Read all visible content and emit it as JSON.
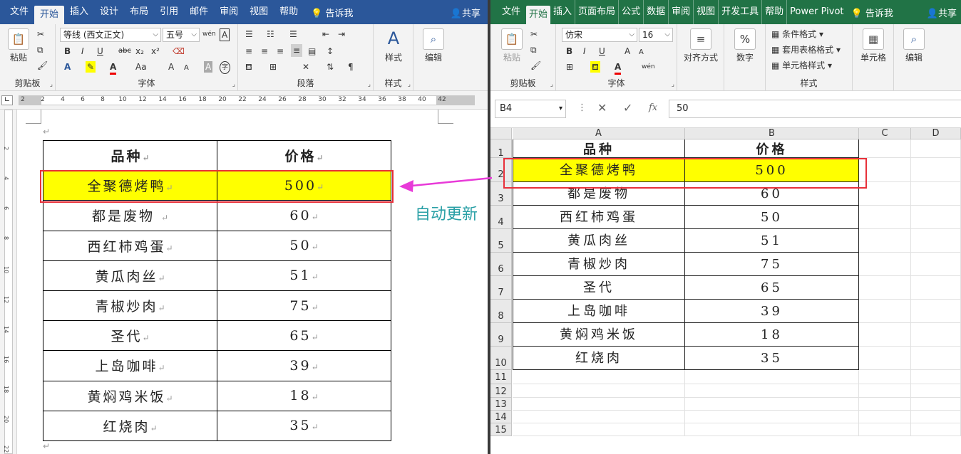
{
  "colors": {
    "word_accent": "#2b579a",
    "excel_accent": "#217346",
    "highlight": "#ffff00",
    "outline": "#e8303a",
    "arrow": "#e83ad8",
    "annotation": "#2aa0a6"
  },
  "word": {
    "tabs": [
      "文件",
      "开始",
      "插入",
      "设计",
      "布局",
      "引用",
      "邮件",
      "审阅",
      "视图",
      "帮助"
    ],
    "active_tab": "开始",
    "tell_me": "告诉我",
    "share": "共享",
    "ribbon": {
      "clipboard": {
        "label": "剪贴板",
        "paste": "粘贴"
      },
      "font": {
        "label": "字体",
        "font_name": "等线 (西文正文)",
        "font_size": "五号",
        "bold": "B",
        "italic": "I",
        "underline": "U",
        "strike": "abc",
        "sub": "x₂",
        "sup": "x²",
        "change_case": "Aa",
        "grow": "A",
        "shrink": "A",
        "pinyin": "wén",
        "border_char": "A"
      },
      "paragraph": {
        "label": "段落"
      },
      "styles": {
        "label": "样式",
        "button": "样式"
      },
      "editing": {
        "button": "编辑"
      }
    },
    "ruler_ticks": [
      "2",
      "2",
      "4",
      "6",
      "8",
      "10",
      "12",
      "14",
      "16",
      "18",
      "20",
      "22",
      "24",
      "26",
      "28",
      "30",
      "32",
      "34",
      "36",
      "38",
      "40",
      "42"
    ],
    "vruler_ticks": [
      "2",
      "4",
      "6",
      "8",
      "10",
      "12",
      "14",
      "16",
      "18",
      "20",
      "22"
    ],
    "table": {
      "header": [
        "品种",
        "价格"
      ],
      "rows": [
        [
          "全聚德烤鸭",
          "500"
        ],
        [
          "都是废物 ",
          "60"
        ],
        [
          "西红柿鸡蛋",
          "50"
        ],
        [
          "黄瓜肉丝",
          "51"
        ],
        [
          "青椒炒肉",
          "75"
        ],
        [
          "圣代",
          "65"
        ],
        [
          "上岛咖啡",
          "39"
        ],
        [
          "黄焖鸡米饭",
          "18"
        ],
        [
          "红烧肉",
          "35"
        ]
      ]
    }
  },
  "annotation": "自动更新",
  "excel": {
    "tabs": [
      "文件",
      "开始",
      "插入",
      "页面布局",
      "公式",
      "数据",
      "审阅",
      "视图",
      "开发工具",
      "帮助",
      "Power Pivot"
    ],
    "active_tab": "开始",
    "tell_me": "告诉我",
    "share": "共享",
    "ribbon": {
      "clipboard": {
        "label": "剪贴板",
        "paste": "粘贴"
      },
      "font": {
        "label": "字体",
        "font_name": "仿宋",
        "font_size": "16",
        "bold": "B",
        "italic": "I",
        "underline": "U",
        "grow": "A",
        "shrink": "A",
        "pinyin": "wén"
      },
      "alignment": {
        "button": "对齐方式"
      },
      "number": {
        "button": "数字",
        "symbol": "%"
      },
      "styles": {
        "label": "样式",
        "cond_format": "条件格式",
        "table_format": "套用表格格式",
        "cell_styles": "单元格样式"
      },
      "cells": {
        "button": "单元格"
      },
      "editing": {
        "button": "编辑"
      }
    },
    "name_box": "B4",
    "fx": "fx",
    "formula": "50",
    "columns": [
      "A",
      "B",
      "C",
      "D"
    ],
    "row_numbers": [
      "1",
      "2",
      "3",
      "4",
      "5",
      "6",
      "7",
      "8",
      "9",
      "10",
      "11",
      "12",
      "13",
      "14",
      "15"
    ],
    "table": {
      "header": [
        "品种",
        "价格"
      ],
      "rows": [
        [
          "全聚德烤鸭",
          "500"
        ],
        [
          "都是废物",
          "60"
        ],
        [
          "西红柿鸡蛋",
          "50"
        ],
        [
          "黄瓜肉丝",
          "51"
        ],
        [
          "青椒炒肉",
          "75"
        ],
        [
          "圣代",
          "65"
        ],
        [
          "上岛咖啡",
          "39"
        ],
        [
          "黄焖鸡米饭",
          "18"
        ],
        [
          "红烧肉",
          "35"
        ]
      ]
    }
  }
}
